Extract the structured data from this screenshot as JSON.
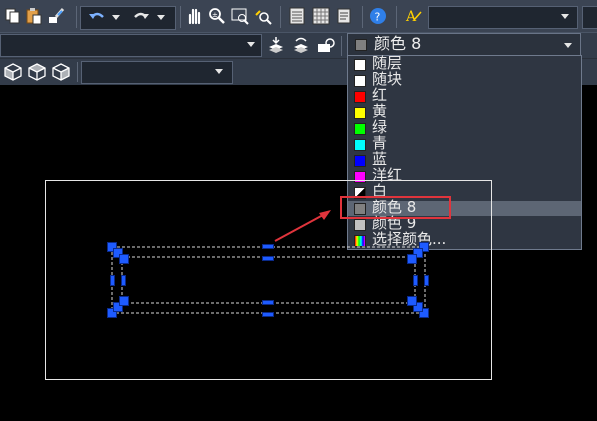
{
  "toolbar": {
    "icons": [
      "copy-icon",
      "paste-icon",
      "match-properties-icon",
      "undo-icon",
      "undo-dropdown-icon",
      "redo-icon",
      "redo-dropdown-icon",
      "pan-icon",
      "zoom-realtime-icon",
      "zoom-window-icon",
      "zoom-previous-icon",
      "properties-icon",
      "design-center-icon",
      "tool-palette-icon",
      "help-icon",
      "text-style-icon"
    ],
    "view_icons": [
      "front-view-icon",
      "top-view-icon",
      "right-view-icon"
    ],
    "layer_icons": [
      "make-current-icon",
      "layer-previous-icon",
      "layer-states-icon"
    ]
  },
  "color_combo": {
    "value": "颜色 8",
    "swatch": "#808080"
  },
  "color_menu": {
    "items": [
      {
        "label": "随层",
        "swatch": "#ffffff"
      },
      {
        "label": "随块",
        "swatch": "#ffffff"
      },
      {
        "label": "红",
        "swatch": "#ff0000"
      },
      {
        "label": "黄",
        "swatch": "#ffff00"
      },
      {
        "label": "绿",
        "swatch": "#00ff00"
      },
      {
        "label": "青",
        "swatch": "#00ffff"
      },
      {
        "label": "蓝",
        "swatch": "#0000ff"
      },
      {
        "label": "洋红",
        "swatch": "#ff00ff"
      },
      {
        "label": "白",
        "swatch": "#ffffff"
      },
      {
        "label": "颜色 8",
        "swatch": "#808080"
      },
      {
        "label": "颜色 9",
        "swatch": "#c0c0c0"
      },
      {
        "label": "选择颜色...",
        "swatch": "multicolor"
      }
    ],
    "selected": "颜色 8"
  },
  "colors": {
    "accent_red": "#e0343c",
    "grip_blue": "#1e5bff"
  }
}
